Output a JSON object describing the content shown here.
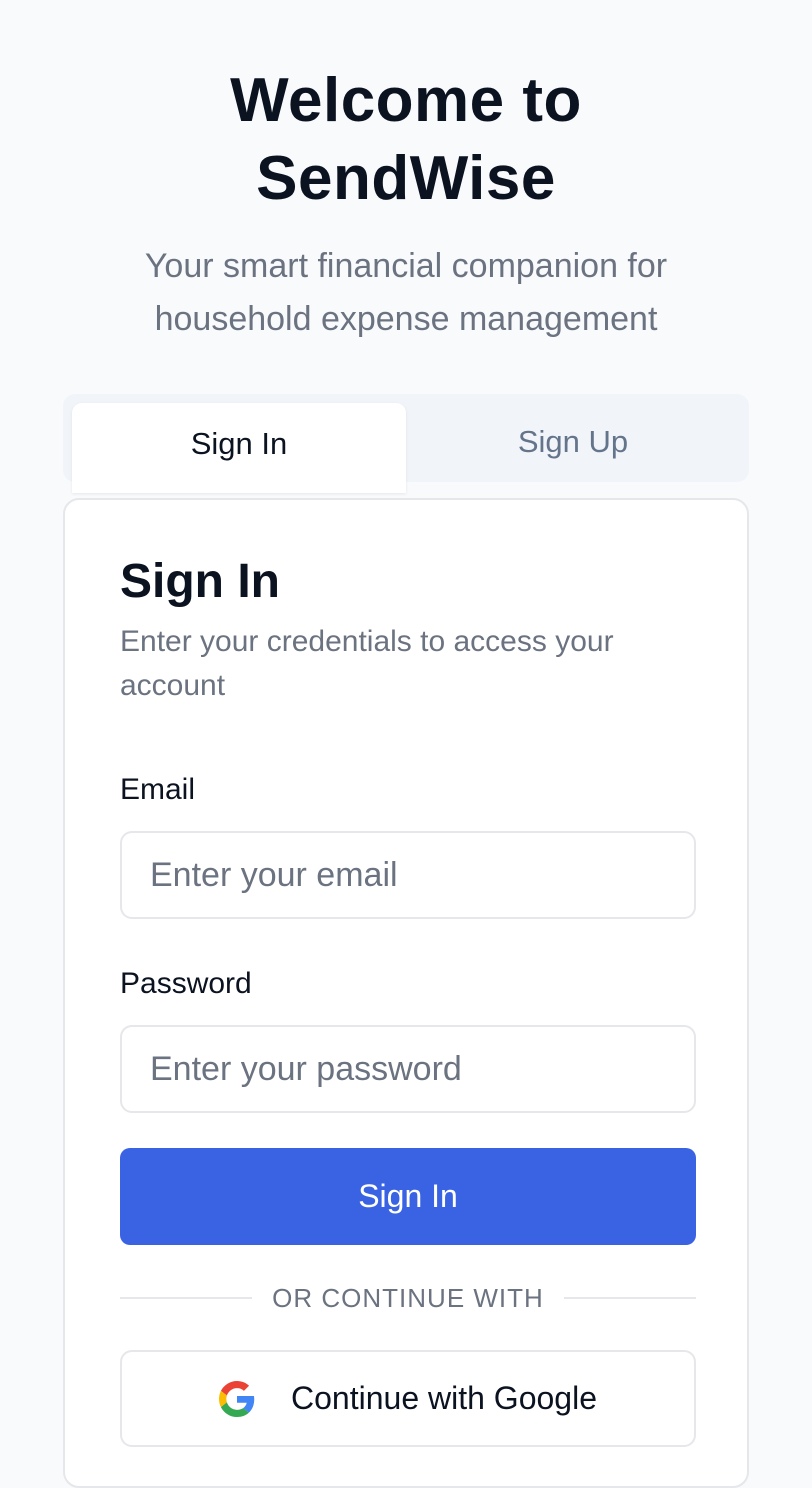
{
  "hero": {
    "title_line1": "Welcome to",
    "title_line2": "SendWise",
    "subtitle": "Your smart financial companion for household expense management"
  },
  "tabs": [
    {
      "label": "Sign In",
      "active": true
    },
    {
      "label": "Sign Up",
      "active": false
    }
  ],
  "card": {
    "title": "Sign In",
    "description": "Enter your credentials to access your account",
    "email": {
      "label": "Email",
      "value": "",
      "placeholder": "Enter your email"
    },
    "password": {
      "label": "Password",
      "value": "",
      "placeholder": "Enter your password"
    },
    "submit_label": "Sign In",
    "divider_text": "OR CONTINUE WITH",
    "google_label": "Continue with Google",
    "google_icon": "google-icon"
  },
  "colors": {
    "background": "#f8fafc",
    "primary": "#3a63e3",
    "text": "#0b1220",
    "muted": "#6b7280",
    "border": "#e5e7eb"
  }
}
